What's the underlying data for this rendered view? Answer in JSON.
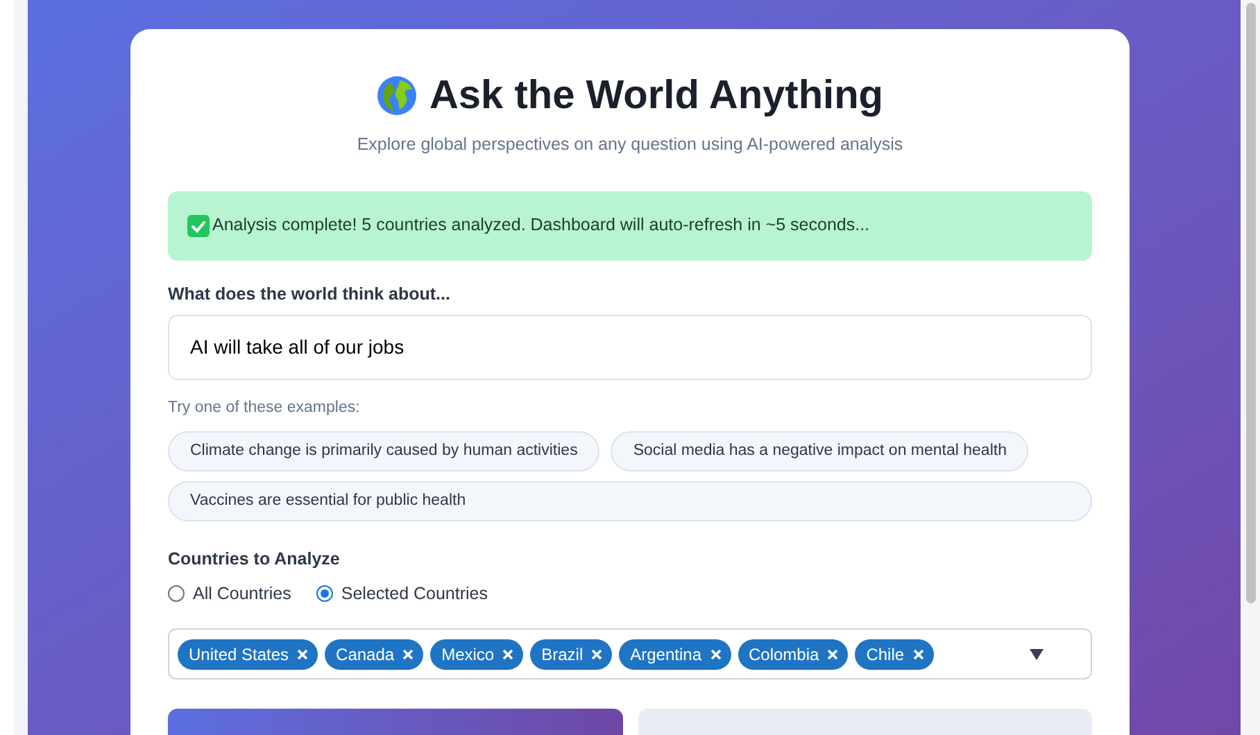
{
  "header": {
    "title": "Ask the World Anything",
    "subtitle": "Explore global perspectives on any question using AI-powered analysis"
  },
  "status": {
    "kind": "success",
    "message": "Analysis complete! 5 countries analyzed. Dashboard will auto-refresh in ~5 seconds..."
  },
  "question": {
    "label": "What does the world think about...",
    "value": "AI will take all of our jobs"
  },
  "examples": {
    "label": "Try one of these examples:",
    "items": [
      {
        "text": "Climate change is primarily caused by human activities"
      },
      {
        "text": "Social media has a negative impact on mental health"
      },
      {
        "text": "Vaccines are essential for public health"
      }
    ]
  },
  "countries": {
    "label": "Countries to Analyze",
    "options": [
      {
        "label": "All Countries",
        "selected": false
      },
      {
        "label": "Selected Countries",
        "selected": true
      }
    ],
    "chips": [
      {
        "label": "United States"
      },
      {
        "label": "Canada"
      },
      {
        "label": "Mexico"
      },
      {
        "label": "Brazil"
      },
      {
        "label": "Argentina"
      },
      {
        "label": "Colombia"
      },
      {
        "label": "Chile"
      }
    ]
  }
}
